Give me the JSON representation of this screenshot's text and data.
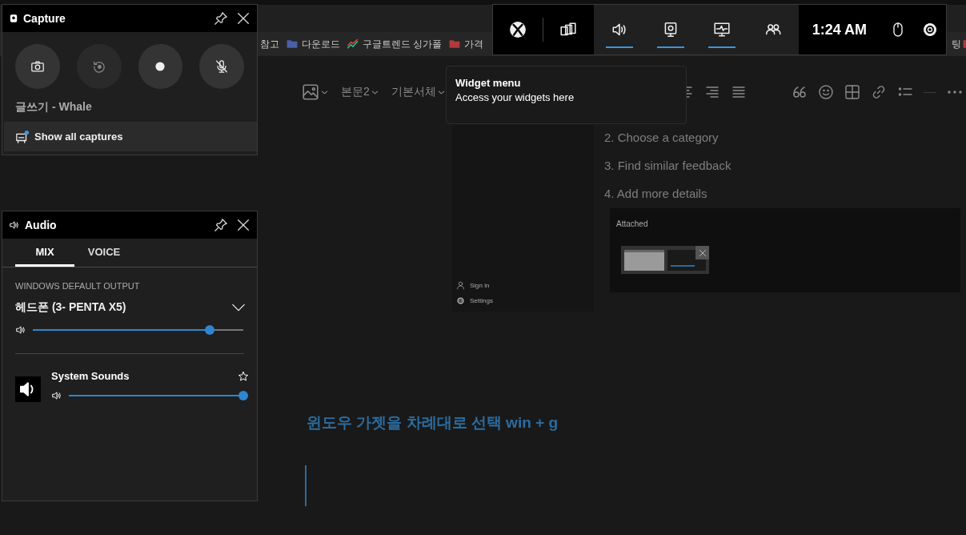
{
  "browser": {
    "bookmarks": [
      {
        "kind": "plain",
        "label": "참고"
      },
      {
        "kind": "folder",
        "color": "#4a5fa8",
        "label": "다운로드"
      },
      {
        "kind": "trend",
        "label": "구글트렌드 싱가폴"
      },
      {
        "kind": "folder",
        "color": "#b03a3a",
        "label": "가격"
      }
    ],
    "bookmark_right": {
      "label": "팅",
      "color": "#b03a3a"
    }
  },
  "editor": {
    "toolbar": {
      "styles": [
        "본문2",
        "기본서체"
      ]
    },
    "sidebar": {
      "items": [
        {
          "kind": "person",
          "label": "Sign in"
        },
        {
          "kind": "settings",
          "label": "Settings"
        }
      ]
    },
    "steps": [
      "2. Choose a category",
      "3. Find similar feedback",
      "4. Add more details"
    ],
    "attached": {
      "title": "Attached"
    },
    "heading": "윈도우 가젯을 차례대로 선택 win + g"
  },
  "game_bar": {
    "items": [
      {
        "kind": "xbox",
        "active": false
      },
      {
        "kind": "widgets",
        "active": false
      },
      {
        "kind": "audio",
        "active": true
      },
      {
        "kind": "capture",
        "active": true
      },
      {
        "kind": "performance",
        "active": true
      },
      {
        "kind": "social",
        "active": false
      }
    ],
    "time": "1:24 AM"
  },
  "widget_tooltip": {
    "title": "Widget menu",
    "text": "Access your widgets here"
  },
  "capture": {
    "title": "Capture",
    "buttons": [
      {
        "kind": "screenshot",
        "disabled": false
      },
      {
        "kind": "record-last",
        "disabled": true
      },
      {
        "kind": "record",
        "disabled": false
      },
      {
        "kind": "mic-off",
        "disabled": false
      }
    ],
    "app_name": "글쓰기 - Whale",
    "show_all": "Show all captures",
    "new_capture": true
  },
  "audio": {
    "title": "Audio",
    "tabs": [
      {
        "label": "MIX",
        "selected": true
      },
      {
        "label": "VOICE",
        "selected": false
      }
    ],
    "section": "WINDOWS DEFAULT OUTPUT",
    "device": "헤드폰 (3- PENTA X5)",
    "level": 0.84,
    "apps": [
      {
        "name": "System Sounds",
        "level": 1.0,
        "favorite": false
      }
    ]
  }
}
